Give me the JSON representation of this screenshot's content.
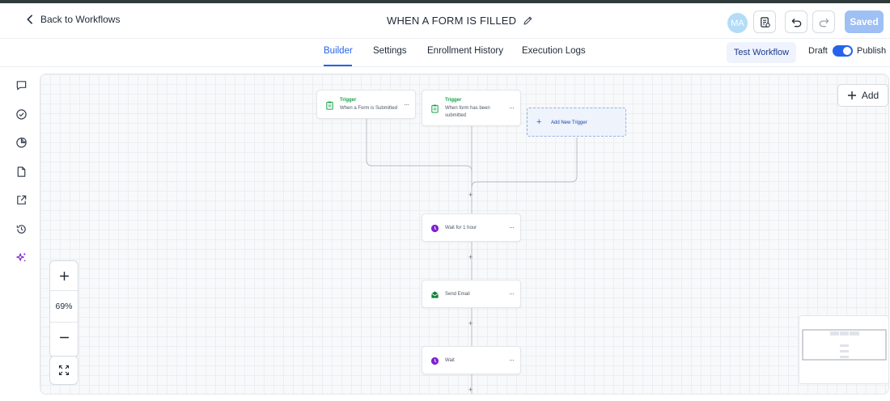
{
  "header": {
    "back_label": "Back to Workflows",
    "workflow_title": "WHEN A FORM IS FILLED",
    "avatar_initials": "MA",
    "saved_label": "Saved"
  },
  "tabs": [
    {
      "label": "Builder",
      "active": true
    },
    {
      "label": "Settings",
      "active": false
    },
    {
      "label": "Enrollment History",
      "active": false
    },
    {
      "label": "Execution Logs",
      "active": false
    }
  ],
  "toolbar": {
    "test_workflow_label": "Test Workflow",
    "draft_label": "Draft",
    "publish_label": "Publish",
    "publish_toggle_on": true
  },
  "sidebar": {
    "icons": [
      "chat-icon",
      "check-circle-icon",
      "pie-chart-icon",
      "document-icon",
      "external-link-icon",
      "history-icon",
      "sparkles-icon"
    ]
  },
  "canvas": {
    "add_label": "Add",
    "zoom_level": "69%",
    "triggers": [
      {
        "type": "Trigger",
        "description": "When a Form is Submitted"
      },
      {
        "type": "Trigger",
        "description_line1": "When form has been",
        "description_line2": "submitted"
      }
    ],
    "add_trigger_label": "Add New Trigger",
    "actions": [
      {
        "label": "Wait for 1 hour",
        "icon": "clock-icon"
      },
      {
        "label": "Send Email",
        "icon": "email-icon"
      },
      {
        "label": "Wait",
        "icon": "clock-icon"
      }
    ],
    "menu_glyph": "···",
    "connector_glyph": "+"
  },
  "colors": {
    "accent": "#2563eb",
    "trigger_green": "#16a34a",
    "wait_purple": "#7e22ce",
    "email_green": "#15803d",
    "saved_button": "#9ec0f5"
  }
}
